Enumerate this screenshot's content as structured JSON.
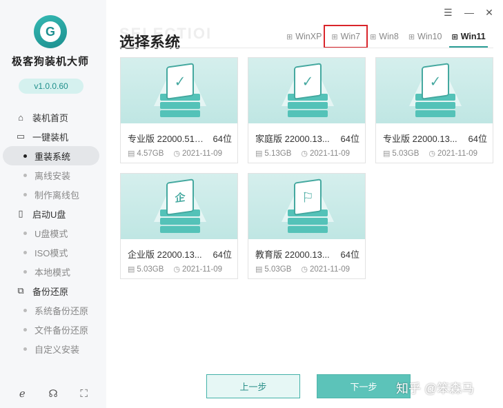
{
  "app": {
    "name": "极客狗装机大师",
    "version": "v1.0.0.60"
  },
  "window": {
    "minimize": "—",
    "close": "✕"
  },
  "nav": [
    {
      "type": "item",
      "label": "装机首页",
      "icon": "home-icon"
    },
    {
      "type": "item",
      "label": "一键装机",
      "icon": "monitor-icon"
    },
    {
      "type": "sub",
      "label": "重装系统",
      "active": true
    },
    {
      "type": "sub",
      "label": "离线安装"
    },
    {
      "type": "sub",
      "label": "制作离线包"
    },
    {
      "type": "item",
      "label": "启动U盘",
      "icon": "usb-icon"
    },
    {
      "type": "sub",
      "label": "U盘模式"
    },
    {
      "type": "sub",
      "label": "ISO模式"
    },
    {
      "type": "sub",
      "label": "本地模式"
    },
    {
      "type": "item",
      "label": "备份还原",
      "icon": "backup-icon"
    },
    {
      "type": "sub",
      "label": "系统备份还原"
    },
    {
      "type": "sub",
      "label": "文件备份还原"
    },
    {
      "type": "sub",
      "label": "自定义安装"
    }
  ],
  "header": {
    "ghost_text": "SELECTIOI",
    "title": "选择系统",
    "tabs": [
      {
        "label": "WinXP",
        "icon": "windows-xp-icon"
      },
      {
        "label": "Win7",
        "icon": "windows-7-icon",
        "highlight": true
      },
      {
        "label": "Win8",
        "icon": "windows-8-icon"
      },
      {
        "label": "Win10",
        "icon": "windows-10-icon"
      },
      {
        "label": "Win11",
        "icon": "windows-11-icon",
        "active": true
      }
    ]
  },
  "cards": [
    {
      "name": "专业版 22000.51 ...",
      "bits": "64位",
      "size": "4.57GB",
      "date": "2021-11-09",
      "glyph": "✓"
    },
    {
      "name": "家庭版 22000.13...",
      "bits": "64位",
      "size": "5.13GB",
      "date": "2021-11-09",
      "glyph": "✓"
    },
    {
      "name": "专业版 22000.13...",
      "bits": "64位",
      "size": "5.03GB",
      "date": "2021-11-09",
      "glyph": "✓"
    },
    {
      "name": "企业版 22000.13...",
      "bits": "64位",
      "size": "5.03GB",
      "date": "2021-11-09",
      "glyph": "企"
    },
    {
      "name": "教育版 22000.13...",
      "bits": "64位",
      "size": "5.03GB",
      "date": "2021-11-09",
      "glyph": "⚐"
    }
  ],
  "buttons": {
    "prev": "上一步",
    "next": "下一步"
  },
  "watermark": "知乎 @笨森马"
}
